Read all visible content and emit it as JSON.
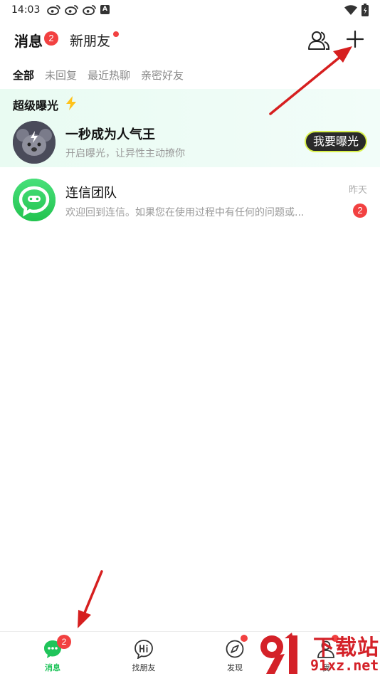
{
  "status_bar": {
    "time": "14:03",
    "left_icons": [
      "weibo-icon",
      "weibo-icon",
      "weibo-icon",
      "a-icon"
    ],
    "a_icon_text": "A",
    "right_icons": [
      "wifi-icon",
      "battery-icon"
    ]
  },
  "header": {
    "tab_messages": "消息",
    "messages_badge": "2",
    "tab_new_friends": "新朋友",
    "right_icons": [
      "contacts-icon",
      "plus-icon"
    ]
  },
  "filters": [
    "全部",
    "未回复",
    "最近热聊",
    "亲密好友"
  ],
  "exposure": {
    "section_title": "超级曝光",
    "title_icon": "lightning-bolt-icon",
    "name": "一秒成为人气王",
    "subtitle": "开启曝光，让异性主动撩你",
    "button_label": "我要曝光"
  },
  "chats": [
    {
      "name": "连信团队",
      "preview": "欢迎回到连信。如果您在使用过程中有任何的问题或...",
      "time": "昨天",
      "unread": "2"
    }
  ],
  "bottom_nav": [
    {
      "label": "消息",
      "icon": "chat-bubble-icon",
      "badge": "2",
      "active": true
    },
    {
      "label": "找朋友",
      "icon": "hi-icon",
      "badge": "",
      "active": false
    },
    {
      "label": "发现",
      "icon": "compass-icon",
      "badge": "",
      "active": false
    },
    {
      "label": "我",
      "icon": "profile-icon",
      "badge": "",
      "active": false
    }
  ],
  "watermark": {
    "top_text": "下载站",
    "bottom_text": "91xz.net"
  },
  "colors": {
    "brand_green": "#2fd36e",
    "badge_red": "#f24141",
    "annotation_red": "#d61f1f",
    "watermark_red": "#d42128"
  }
}
